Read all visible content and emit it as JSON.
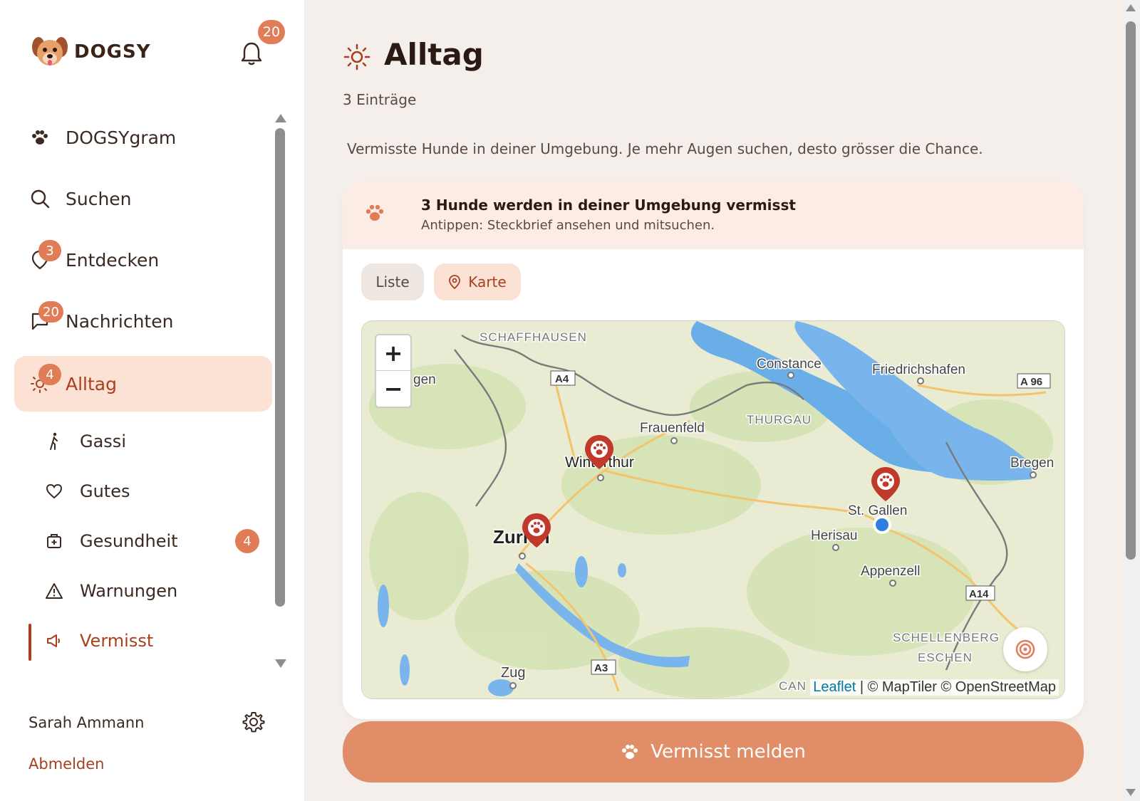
{
  "app": {
    "logo_text": "DOGSY",
    "notification_count": "20"
  },
  "sidebar": {
    "items": [
      {
        "label": "DOGSYgram",
        "icon": "paw-icon",
        "badge": ""
      },
      {
        "label": "Suchen",
        "icon": "search-icon",
        "badge": ""
      },
      {
        "label": "Entdecken",
        "icon": "map-pin-icon",
        "badge": "3"
      },
      {
        "label": "Nachrichten",
        "icon": "chat-icon",
        "badge": "20"
      },
      {
        "label": "Alltag",
        "icon": "sun-icon",
        "badge": "4",
        "active": true
      }
    ],
    "sub_items": [
      {
        "label": "Gassi",
        "icon": "walk-icon",
        "badge": ""
      },
      {
        "label": "Gutes",
        "icon": "heart-icon",
        "badge": ""
      },
      {
        "label": "Gesundheit",
        "icon": "medical-bag-icon",
        "badge": "4"
      },
      {
        "label": "Warnungen",
        "icon": "warning-icon",
        "badge": ""
      },
      {
        "label": "Vermisst",
        "icon": "megaphone-icon",
        "badge": "",
        "active": true
      }
    ],
    "user_name": "Sarah Ammann",
    "logout_label": "Abmelden"
  },
  "main": {
    "title": "Alltag",
    "entries": "3 Einträge",
    "intro": "Vermisste Hunde in deiner Umgebung. Je mehr Augen suchen, desto grösser die Chance.",
    "card": {
      "title": "3 Hunde werden in deiner Umgebung vermisst",
      "subtitle": "Antippen: Steckbrief ansehen und mitsuchen."
    },
    "toggle": {
      "list_label": "Liste",
      "map_label": "Karte"
    },
    "map": {
      "zoom_in": "+",
      "zoom_out": "−",
      "places": [
        "SCHAFFHAUSEN",
        "Constance",
        "Friedrichshafen",
        "Frauenfeld",
        "THURGAU",
        "Winterthur",
        "Zurich",
        "St. Gallen",
        "Herisau",
        "Appenzell",
        "Bregen",
        "Zug",
        "SCHELLENBERG",
        "ESCHEN",
        "gen",
        "CAN"
      ],
      "road_labels": [
        "A4",
        "A 96",
        "A14",
        "A3"
      ],
      "attribution_link": "Leaflet",
      "attribution_text": " | © MapTiler © OpenStreetMap",
      "markers": 3
    },
    "report_button": "Vermisst melden"
  },
  "colors": {
    "accent": "#e07d57",
    "active_text": "#a8401f",
    "active_bg": "#fce1d5",
    "button": "#e08d68",
    "marker": "#c0392b"
  }
}
